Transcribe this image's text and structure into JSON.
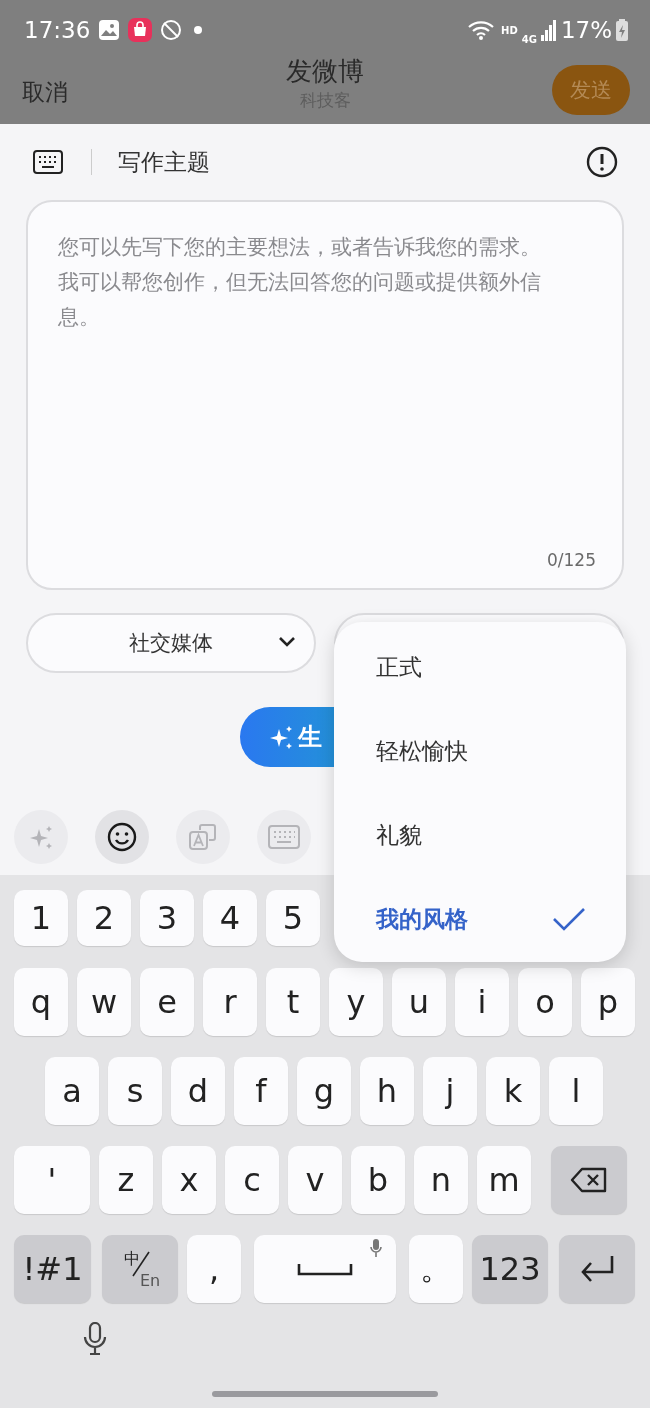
{
  "status_bar": {
    "time": "17:36",
    "hd": "HD",
    "network": "4G",
    "battery": "17%"
  },
  "header": {
    "cancel": "取消",
    "title": "发微博",
    "subtitle": "科技客",
    "send": "发送"
  },
  "topic": {
    "label": "写作主题"
  },
  "prompt": {
    "placeholder": [
      "您可以先写下您的主要想法，或者告诉我您的需求。",
      "我可以帮您创作，但无法回答您的问题或提供额外信息。"
    ],
    "counter": "0/125"
  },
  "dropdowns": [
    {
      "value": "社交媒体"
    }
  ],
  "generate_button": {
    "label": "生"
  },
  "toolbar": [
    {
      "kind": "ai",
      "selected": false
    },
    {
      "kind": "emoji",
      "selected": true
    },
    {
      "kind": "translate",
      "selected": false
    },
    {
      "kind": "keyboard",
      "selected": false
    }
  ],
  "tone_menu": [
    {
      "label": "正式",
      "selected": false
    },
    {
      "label": "轻松愉快",
      "selected": false
    },
    {
      "label": "礼貌",
      "selected": false
    },
    {
      "label": "我的风格",
      "selected": true
    }
  ],
  "keyboard": {
    "number_row": {
      "keys": [
        "1",
        "2",
        "3",
        "4",
        "5"
      ]
    },
    "top_letter_row": {
      "keys": [
        "q",
        "w",
        "e",
        "r",
        "t",
        "y",
        "u",
        "i",
        "o",
        "p"
      ]
    },
    "middle_letter_row": {
      "keys": [
        "a",
        "s",
        "d",
        "f",
        "g",
        "h",
        "j",
        "k",
        "l"
      ]
    },
    "bottom_letter_row": {
      "keys": [
        {
          "kind": "char",
          "label": "'"
        },
        "z",
        "x",
        "c",
        "v",
        "b",
        "n",
        "m",
        {
          "kind": "backspace"
        }
      ]
    },
    "function_row": {
      "keys": [
        {
          "kind": "function",
          "label": "!#1"
        },
        {
          "kind": "lang",
          "top": "中",
          "bottom": "En"
        },
        {
          "kind": "char",
          "label": ","
        },
        {
          "kind": "space"
        },
        {
          "kind": "char",
          "label": "。"
        },
        {
          "kind": "function",
          "label": "123"
        },
        {
          "kind": "enter"
        }
      ]
    }
  }
}
